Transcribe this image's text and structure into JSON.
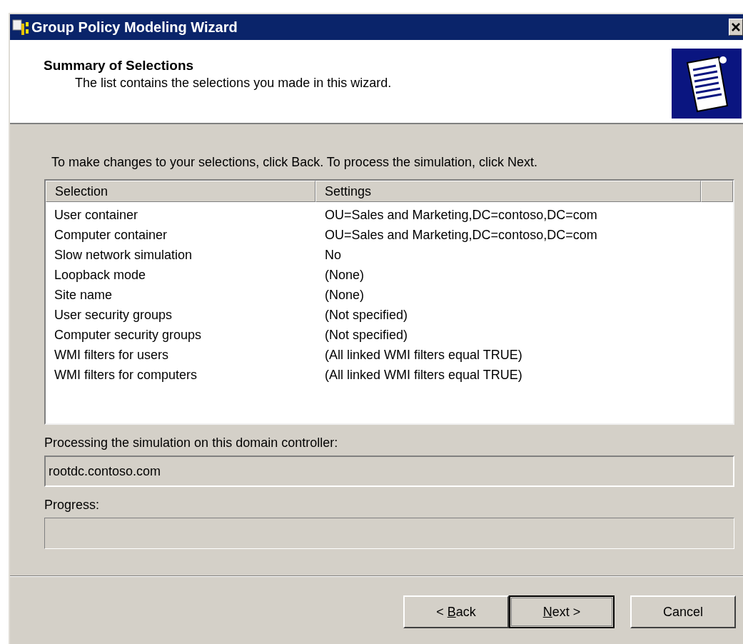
{
  "window": {
    "title": "Group Policy Modeling Wizard"
  },
  "header": {
    "title": "Summary of Selections",
    "subtitle": "The list contains the selections you made in this wizard."
  },
  "instruction": "To make changes to your selections, click Back. To process the simulation, click Next.",
  "table": {
    "columns": [
      "Selection",
      "Settings"
    ],
    "rows": [
      {
        "selection": "User container",
        "settings": "OU=Sales and Marketing,DC=contoso,DC=com"
      },
      {
        "selection": "Computer container",
        "settings": "OU=Sales and Marketing,DC=contoso,DC=com"
      },
      {
        "selection": "Slow network simulation",
        "settings": "No"
      },
      {
        "selection": "Loopback mode",
        "settings": "(None)"
      },
      {
        "selection": "Site name",
        "settings": "(None)"
      },
      {
        "selection": "User security groups",
        "settings": "(Not specified)"
      },
      {
        "selection": "Computer security groups",
        "settings": "(Not specified)"
      },
      {
        "selection": "WMI filters for users",
        "settings": "(All linked WMI filters equal TRUE)"
      },
      {
        "selection": "WMI filters for computers",
        "settings": "(All linked WMI filters equal TRUE)"
      }
    ]
  },
  "domain_controller": {
    "label": "Processing the simulation on this domain controller:",
    "value": "rootdc.contoso.com"
  },
  "progress": {
    "label": "Progress:",
    "level": 0
  },
  "buttons": [
    {
      "text_before_key": "< ",
      "access_key": "B",
      "text_after_key": "ack",
      "default": false
    },
    {
      "access_key": "N",
      "text_after_key": "ext >",
      "default": true
    },
    {
      "label": "Cancel",
      "default": false
    }
  ]
}
